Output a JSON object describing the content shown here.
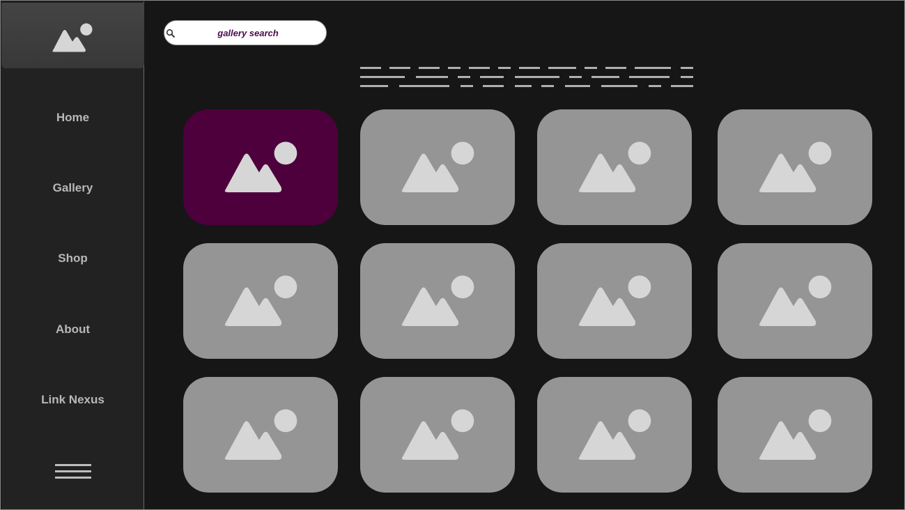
{
  "sidebar": {
    "items": [
      {
        "label": "Home",
        "name": "sidebar-item-home"
      },
      {
        "label": "Gallery",
        "name": "sidebar-item-gallery"
      },
      {
        "label": "Shop",
        "name": "sidebar-item-shop"
      },
      {
        "label": "About",
        "name": "sidebar-item-about"
      },
      {
        "label": "Link Nexus",
        "name": "sidebar-item-link-nexus"
      }
    ],
    "logo_icon": "image-placeholder-icon",
    "menu_icon": "hamburger-menu-icon"
  },
  "search": {
    "placeholder": "gallery search",
    "value": "",
    "icon": "search-icon"
  },
  "gallery": {
    "tiles": [
      {
        "active": true
      },
      {
        "active": false
      },
      {
        "active": false
      },
      {
        "active": false
      },
      {
        "active": false
      },
      {
        "active": false
      },
      {
        "active": false
      },
      {
        "active": false
      },
      {
        "active": false
      },
      {
        "active": false
      },
      {
        "active": false
      },
      {
        "active": false
      }
    ],
    "tile_icon": "image-placeholder-icon"
  },
  "colors": {
    "background": "#161616",
    "sidebar": "#222222",
    "tile": "#959595",
    "tile_active": "#4e003c",
    "accent_text": "#4a0a4a"
  }
}
